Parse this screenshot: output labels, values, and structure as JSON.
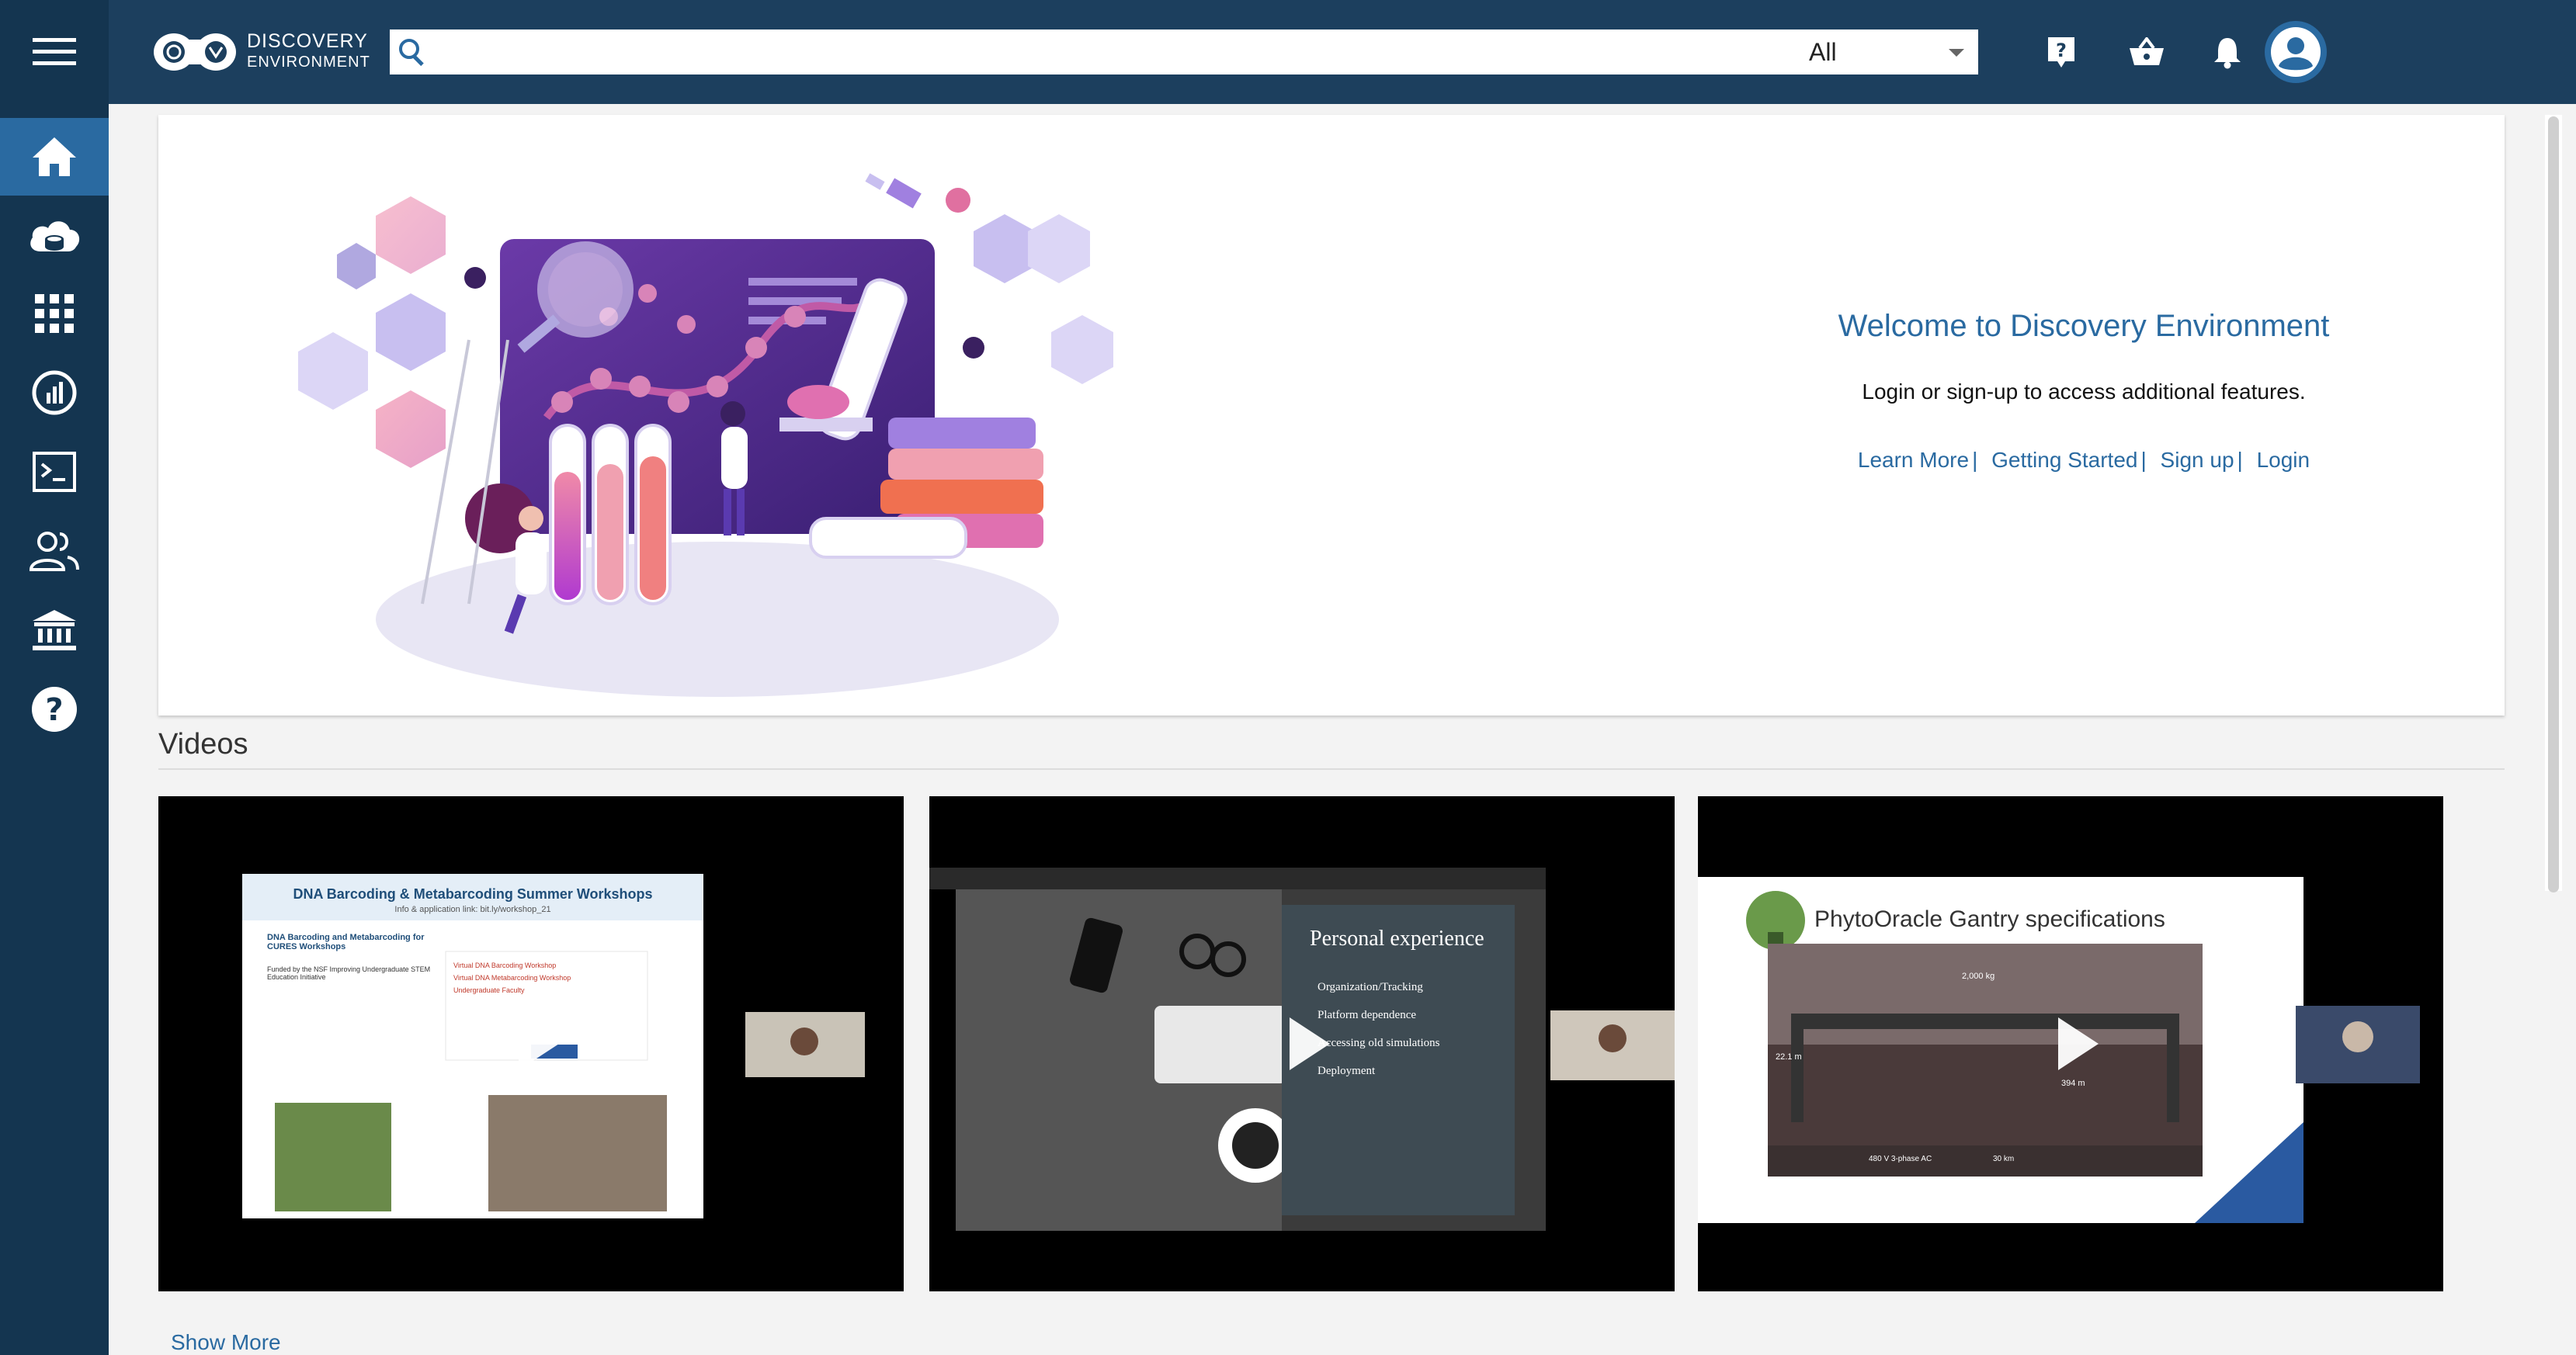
{
  "header": {
    "logo_line1": "DISCOVERY",
    "logo_line2": "ENVIRONMENT",
    "search": {
      "placeholder": "",
      "value": "",
      "scope_selected": "All"
    },
    "icons": [
      "help-icon",
      "basket-icon",
      "notifications-icon",
      "account-icon"
    ]
  },
  "sidebar": {
    "items": [
      {
        "name": "home",
        "icon": "home-icon",
        "active": true
      },
      {
        "name": "data",
        "icon": "cloud-data-icon"
      },
      {
        "name": "apps",
        "icon": "apps-grid-icon"
      },
      {
        "name": "analyses",
        "icon": "analyses-icon"
      },
      {
        "name": "vice",
        "icon": "terminal-icon"
      },
      {
        "name": "teams",
        "icon": "teams-icon"
      },
      {
        "name": "collections",
        "icon": "institution-icon"
      },
      {
        "name": "help",
        "icon": "help-circle-icon"
      }
    ]
  },
  "welcome": {
    "title": "Welcome to Discovery Environment",
    "subtitle": "Login or sign-up to access additional features.",
    "links": [
      "Learn More",
      "Getting Started",
      "Sign up",
      "Login"
    ],
    "separator": "|"
  },
  "videos": {
    "heading": "Videos",
    "items": [
      {
        "slide_title": "DNA Barcoding & Metabarcoding Summer Workshops",
        "slide_sub": "Info & application link: bit.ly/workshop_21",
        "slide_heading": "DNA Barcoding and Metabarcoding for CURES Workshops",
        "slide_note": "Funded by the NSF Improving Undergraduate STEM Education Initiative",
        "bullets": [
          "Virtual DNA Barcoding Workshop",
          "Virtual DNA Metabarcoding Workshop",
          "Undergraduate Faculty"
        ]
      },
      {
        "slide_title": "Personal experience",
        "bullets": [
          "Organization/Tracking",
          "Platform dependence",
          "Accessing old simulations",
          "Deployment"
        ]
      },
      {
        "slide_title": "PhytoOracle Gantry specifications",
        "labels": [
          "2,000 kg",
          "22.1 m",
          "394 m",
          "480 V 3-phase AC",
          "30 km"
        ]
      }
    ],
    "show_more": "Show More"
  }
}
